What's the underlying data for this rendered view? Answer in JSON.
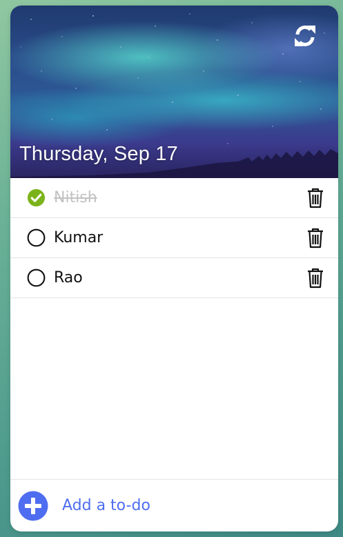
{
  "header": {
    "date": "Thursday, Sep 17",
    "refresh_icon": "sync-icon"
  },
  "todos": [
    {
      "text": "Nitish",
      "done": true
    },
    {
      "text": "Kumar",
      "done": false
    },
    {
      "text": "Rao",
      "done": false
    }
  ],
  "footer": {
    "add_label": "Add a to-do",
    "add_icon": "plus-circle-icon"
  },
  "colors": {
    "check_done": "#7bb31a",
    "accent": "#4f6df0",
    "background_gradient_start": "#8fc7a0",
    "background_gradient_end": "#3f8a86"
  }
}
